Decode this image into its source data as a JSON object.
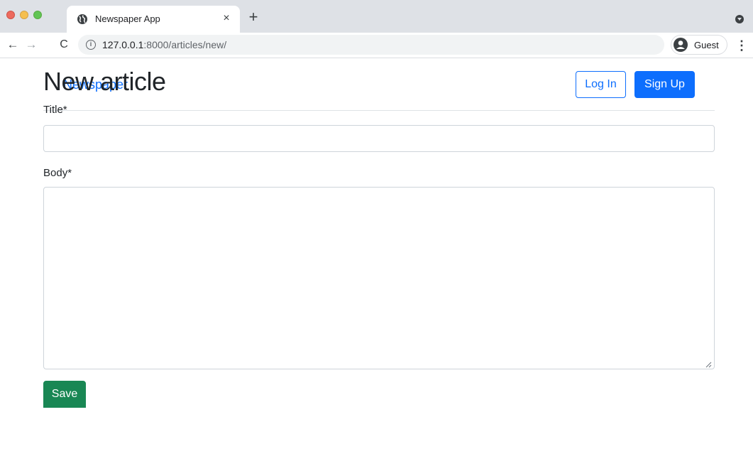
{
  "browser": {
    "tab": {
      "title": "Newspaper App",
      "close_glyph": "×",
      "favicon": "globe-icon"
    },
    "new_tab_glyph": "+",
    "nav": {
      "back_glyph": "←",
      "forward_glyph": "→",
      "reload_glyph": "C"
    },
    "address": {
      "host": "127.0.0.1",
      "path": ":8000/articles/new/",
      "info_glyph": "i"
    },
    "profile": {
      "label": "Guest",
      "icon": "person-icon"
    },
    "menu_glyph": "⋮",
    "colors": {
      "tabstrip": "#dee1e6",
      "omnibox": "#f1f3f4"
    }
  },
  "navbar": {
    "brand": "Newspaper",
    "login_label": "Log In",
    "signup_label": "Sign Up"
  },
  "form": {
    "heading": "New article",
    "title_label": "Title*",
    "title_value": "",
    "body_label": "Body*",
    "body_value": "",
    "save_label": "Save"
  },
  "colors": {
    "primary": "#0d6efd",
    "success": "#198754",
    "text": "#212529",
    "border": "#ced4da"
  }
}
